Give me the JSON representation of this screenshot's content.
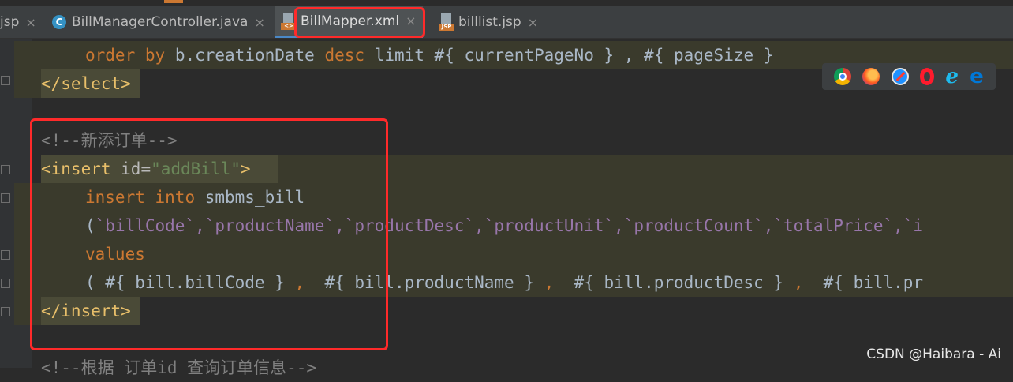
{
  "tabs": [
    {
      "label": "jsp",
      "icon": "jsp-file-icon"
    },
    {
      "label": "BillManagerController.java",
      "icon": "java-class-icon"
    },
    {
      "label": "BillMapper.xml",
      "icon": "xml-file-icon",
      "active": true
    },
    {
      "label": "billlist.jsp",
      "icon": "jsp-file-icon"
    }
  ],
  "tab_close_glyph": "×",
  "code_lines": {
    "l0_order": "order",
    "l0_by": "by",
    "l0_mid": " b.creationDate ",
    "l0_desc": "desc",
    "l0_rest": " limit #{ currentPageNo } , #{ pageSize }",
    "l1": "</select>",
    "l3_comment": "<!--新添订单-->",
    "l4_open": "<insert ",
    "l4_attr": "id=",
    "l4_val": "\"addBill\"",
    "l4_close": ">",
    "l5_insert": "insert",
    "l5_into": "into",
    "l5_rest": " smbms_bill",
    "l6_open": "(",
    "l6_cols": "`billCode`,`productName`,`productDesc`,`productUnit`,`productCount`,`totalPrice`,`i",
    "l7_values": "values",
    "l8_a": "( #{ bill.billCode } ",
    "l8_c1": ",",
    "l8_b": "  #{ bill.productName } ",
    "l8_c2": ",",
    "l8_c": "  #{ bill.productDesc } ",
    "l8_c3": ",",
    "l8_d": "  #{ bill.pr",
    "l9": "</insert>",
    "l11_partial": "<!--根据 订单id 查询订单信息-->"
  },
  "browser_icons": [
    "chrome-icon",
    "firefox-icon",
    "safari-icon",
    "opera-icon",
    "ie-icon",
    "edge-icon"
  ],
  "colors": {
    "highlight_box": "#ff2a2a",
    "active_tab_underline": "#4a88c7"
  },
  "watermark": "CSDN @Haibara - Ai"
}
